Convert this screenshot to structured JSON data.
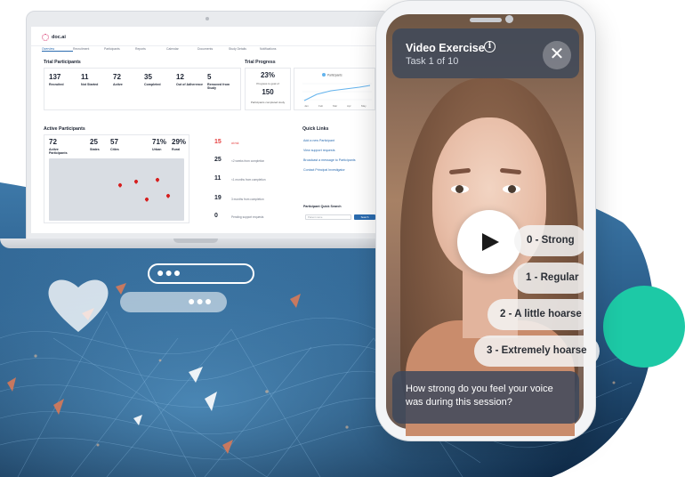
{
  "colors": {
    "accent": "#2b6cb0",
    "teal": "#1dc9a6",
    "alert": "#e53e3e"
  },
  "dashboard": {
    "app_name": "doc.ai",
    "nav": [
      "Overview",
      "Recruitment",
      "Participants",
      "Reports",
      "Calendar",
      "Documents",
      "Study Details",
      "Notifications"
    ],
    "trial_participants": {
      "title": "Trial Participants",
      "stats": [
        {
          "value": "137",
          "label": "Recruited"
        },
        {
          "value": "11",
          "label": "Not Started"
        },
        {
          "value": "72",
          "label": "Active"
        },
        {
          "value": "35",
          "label": "Completed"
        },
        {
          "value": "12",
          "label": "Out of Adherence"
        },
        {
          "value": "5",
          "label": "Removed from Study"
        }
      ]
    },
    "trial_progress": {
      "title": "Trial Progress",
      "percent": "23%",
      "percent_label": "Progress to goal of",
      "goal": "150",
      "goal_label": "Participants completed study",
      "legend": "Participants",
      "months": [
        "Jan",
        "Feb",
        "Mar",
        "Apr",
        "May"
      ]
    },
    "active_participants": {
      "title": "Active Participants",
      "stats": [
        {
          "value": "72",
          "label": "Active Participants"
        },
        {
          "value": "25",
          "label": "States"
        },
        {
          "value": "57",
          "label": "Cities"
        },
        {
          "value": "71%",
          "label": "Urban"
        },
        {
          "value": "29%",
          "label": "Rural"
        }
      ],
      "side": [
        {
          "value": "15",
          "label": "at risk"
        },
        {
          "value": "25",
          "label": "<2 weeks from completion"
        },
        {
          "value": "11",
          "label": "<1 months from completion"
        },
        {
          "value": "19",
          "label": "3 months from completion"
        },
        {
          "value": "0",
          "label": "Pending support requests"
        }
      ]
    },
    "quick_links": {
      "title": "Quick Links",
      "links": [
        "Add a new Participant",
        "View support requests",
        "Broadcast a message to Participants",
        "Contact Principal Investigator"
      ],
      "search_title": "Participant Quick Search",
      "search_placeholder": "Patient name",
      "search_button": "Search"
    }
  },
  "video": {
    "title": "Video Exercise",
    "task": "Task 1 of 10",
    "options": [
      "0 - Strong",
      "1 - Regular",
      "2 - A little hoarse",
      "3 - Extremely hoarse"
    ],
    "question": "How strong do you feel your voice was during this session?"
  },
  "icons": {
    "info": "info-icon",
    "close": "close-icon",
    "play": "play-icon",
    "heart": "heart-icon"
  }
}
